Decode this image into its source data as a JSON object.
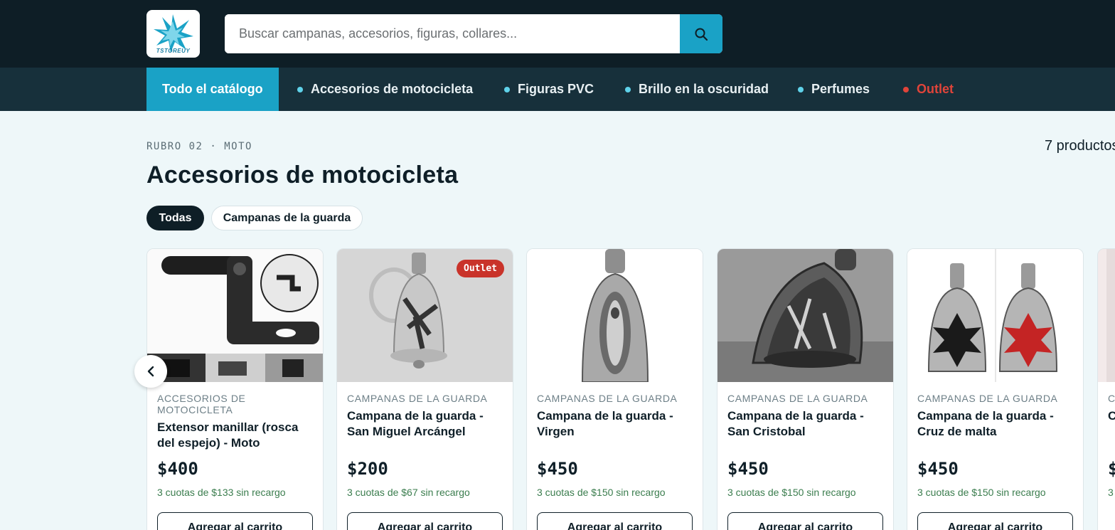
{
  "header": {
    "logo_text": "TSTOREUY",
    "search": {
      "placeholder": "Buscar campanas, accesorios, figuras, collares...",
      "value": ""
    },
    "search_icon": "search-icon"
  },
  "nav": {
    "items": [
      {
        "label": "Todo el catálogo"
      },
      {
        "label": "Accesorios de motocicleta"
      },
      {
        "label": "Figuras PVC"
      },
      {
        "label": "Brillo en la oscuridad"
      },
      {
        "label": "Perfumes"
      },
      {
        "label": "Outlet"
      }
    ]
  },
  "main": {
    "eyebrow": "RUBRO 02 · MOTO",
    "title": "Accesorios de motocicleta",
    "count": "7 productos",
    "filters": [
      "Todas",
      "Campanas de la guarda"
    ]
  },
  "products": [
    {
      "category": "Accesorios de motocicleta",
      "name": "Extensor manillar (rosca del espejo) - Moto",
      "price": "$400",
      "installments": "3 cuotas de $133 sin recargo",
      "button": "Agregar al carrito"
    },
    {
      "category": "Campanas de la guarda",
      "name": "Campana de la guarda - San Miguel Arcángel",
      "price": "$200",
      "installments": "3 cuotas de $67 sin recargo",
      "button": "Agregar al carrito",
      "badge": "Outlet"
    },
    {
      "category": "Campanas de la guarda",
      "name": "Campana de la guarda - Virgen",
      "price": "$450",
      "installments": "3 cuotas de $150 sin recargo",
      "button": "Agregar al carrito"
    },
    {
      "category": "Campanas de la guarda",
      "name": "Campana de la guarda - San Cristobal",
      "price": "$450",
      "installments": "3 cuotas de $150 sin recargo",
      "button": "Agregar al carrito"
    },
    {
      "category": "Campanas de la guarda",
      "name": "Campana de la guarda - Cruz de malta",
      "price": "$450",
      "installments": "3 cuotas de $150 sin recargo",
      "button": "Agregar al carrito"
    },
    {
      "category": "C",
      "name": "C",
      "price": "$",
      "installments": "3"
    }
  ],
  "carousel": {
    "prev_icon": "chevron-left-icon"
  },
  "colors": {
    "header_bg": "#0e1e26",
    "nav_bg": "#17303b",
    "accent": "#1aa2c6",
    "outlet_red": "#e0443a",
    "installments_green": "#3b7d4e",
    "page_bg": "#eef7f9"
  }
}
